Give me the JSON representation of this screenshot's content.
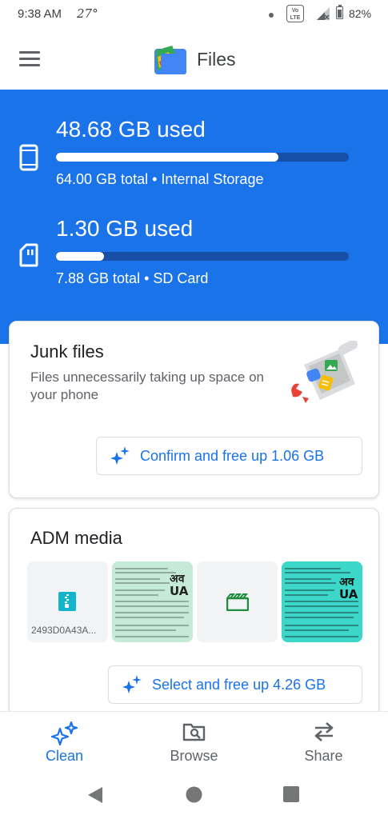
{
  "status_bar": {
    "time": "9:38 AM",
    "temperature": "27°",
    "volte": "Vo LTE",
    "battery": "82%"
  },
  "app_bar": {
    "title": "Files",
    "icons": [
      "menu-icon",
      "files-logo"
    ]
  },
  "storage": [
    {
      "used": "48.68 GB used",
      "subtitle": "64.00 GB total • Internal Storage",
      "fraction_used": 0.76,
      "icon": "phone-icon"
    },
    {
      "used": "1.30 GB used",
      "subtitle": "7.88 GB total • SD Card",
      "fraction_used": 0.165,
      "icon": "sd-card-icon"
    }
  ],
  "junk_card": {
    "title": "Junk files",
    "description": "Files unnecessarily taking up space on your phone",
    "button_label": "Confirm and free up 1.06 GB",
    "illustration": "junk-dustpan-illustration"
  },
  "adm_card": {
    "title": "ADM media",
    "items": [
      {
        "type": "archive",
        "label": "2493D0A43A...",
        "icon": "zip-icon"
      },
      {
        "type": "image",
        "label": "",
        "icon": "certificate-thumbnail"
      },
      {
        "type": "video",
        "label": "",
        "icon": "movie-icon"
      },
      {
        "type": "image",
        "label": "",
        "icon": "certificate-thumbnail"
      }
    ],
    "button_label": "Select and free up 4.26 GB"
  },
  "bottom_nav": [
    {
      "label": "Clean",
      "icon": "sparkle-icon",
      "active": true
    },
    {
      "label": "Browse",
      "icon": "browse-icon",
      "active": false
    },
    {
      "label": "Share",
      "icon": "share-icon",
      "active": false
    }
  ],
  "colors": {
    "accent": "#1a73e8",
    "header_bg": "#1a73e8",
    "track": "#174ea6"
  }
}
